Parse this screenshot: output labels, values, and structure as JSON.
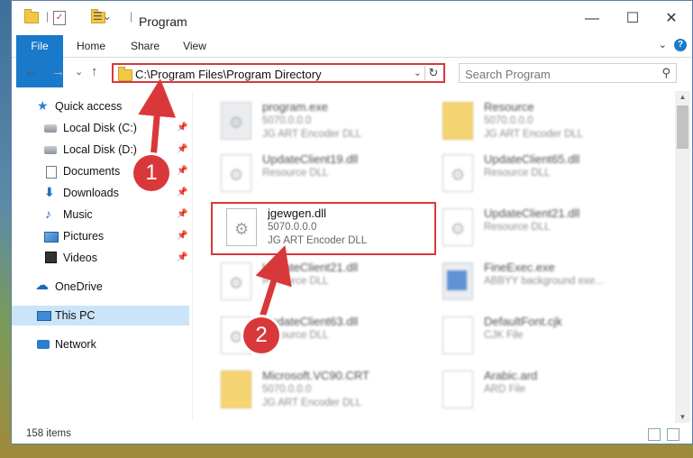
{
  "window": {
    "title": "Program",
    "controls": {
      "minimize": "—",
      "maximize": "☐",
      "close": "✕"
    }
  },
  "ribbon": {
    "tabs": [
      "File",
      "Home",
      "Share",
      "View"
    ],
    "help": "?",
    "collapse": "⌄"
  },
  "nav": {
    "back": "←",
    "forward": "→",
    "recent": "⌄",
    "up": "↑"
  },
  "address": {
    "path": "C:\\Program Files\\Program Directory",
    "dropdown": "⌄",
    "refresh": "↻"
  },
  "search": {
    "placeholder": "Search Program",
    "icon": "⚲"
  },
  "sidebar": {
    "items": [
      {
        "label": "Quick access",
        "icon": "star-icon"
      },
      {
        "label": "Local Disk (C:)",
        "icon": "disk-icon",
        "pinned": true
      },
      {
        "label": "Local Disk (D:)",
        "icon": "disk-icon",
        "pinned": true
      },
      {
        "label": "Documents",
        "icon": "documents-icon",
        "pinned": true
      },
      {
        "label": "Downloads",
        "icon": "downloads-icon",
        "pinned": true
      },
      {
        "label": "Music",
        "icon": "music-icon",
        "pinned": true
      },
      {
        "label": "Pictures",
        "icon": "pictures-icon",
        "pinned": true
      },
      {
        "label": "Videos",
        "icon": "videos-icon",
        "pinned": true
      },
      {
        "label": "OneDrive",
        "icon": "cloud-icon"
      },
      {
        "label": "This PC",
        "icon": "pc-icon",
        "selected": true
      },
      {
        "label": "Network",
        "icon": "network-icon"
      }
    ],
    "pin_glyph": "📌"
  },
  "files": [
    {
      "name": "program.exe",
      "line1": "5070.0.0.0",
      "line2": "JG ART Encoder DLL",
      "type": "exe"
    },
    {
      "name": "Resource",
      "line1": "5070.0.0.0",
      "line2": "JG ART Encoder DLL",
      "type": "folder"
    },
    {
      "name": "UpdateClient19.dll",
      "line1": "Resource DLL",
      "line2": "",
      "type": "dll"
    },
    {
      "name": "UpdateClient65.dll",
      "line1": "Resource DLL",
      "line2": "",
      "type": "dll"
    },
    {
      "name": "jgewgen.dll",
      "line1": "5070.0.0.0",
      "line2": "JG ART Encoder DLL",
      "type": "dll"
    },
    {
      "name": "UpdateClient21.dll",
      "line1": "Resource DLL",
      "line2": "",
      "type": "dll"
    },
    {
      "name": "UpdateClient21.dll",
      "line1": "Resource DLL",
      "line2": "",
      "type": "dll"
    },
    {
      "name": "FineExec.exe",
      "line1": "ABBYY background exe...",
      "line2": "",
      "type": "app"
    },
    {
      "name": "UpdateClient63.dll",
      "line1": "Resource DLL",
      "line2": "",
      "type": "dll"
    },
    {
      "name": "DefaultFont.cjk",
      "line1": "CJK File",
      "line2": "",
      "type": "doc"
    },
    {
      "name": "Microsoft.VC90.CRT",
      "line1": "5070.0.0.0",
      "line2": "JG ART Encoder DLL",
      "type": "folder"
    },
    {
      "name": "Arabic.ard",
      "line1": "ARD File",
      "line2": "",
      "type": "doc"
    }
  ],
  "status": {
    "count": "158 items"
  },
  "annotations": {
    "step1": "1",
    "step2": "2",
    "color": "#d9383a"
  }
}
